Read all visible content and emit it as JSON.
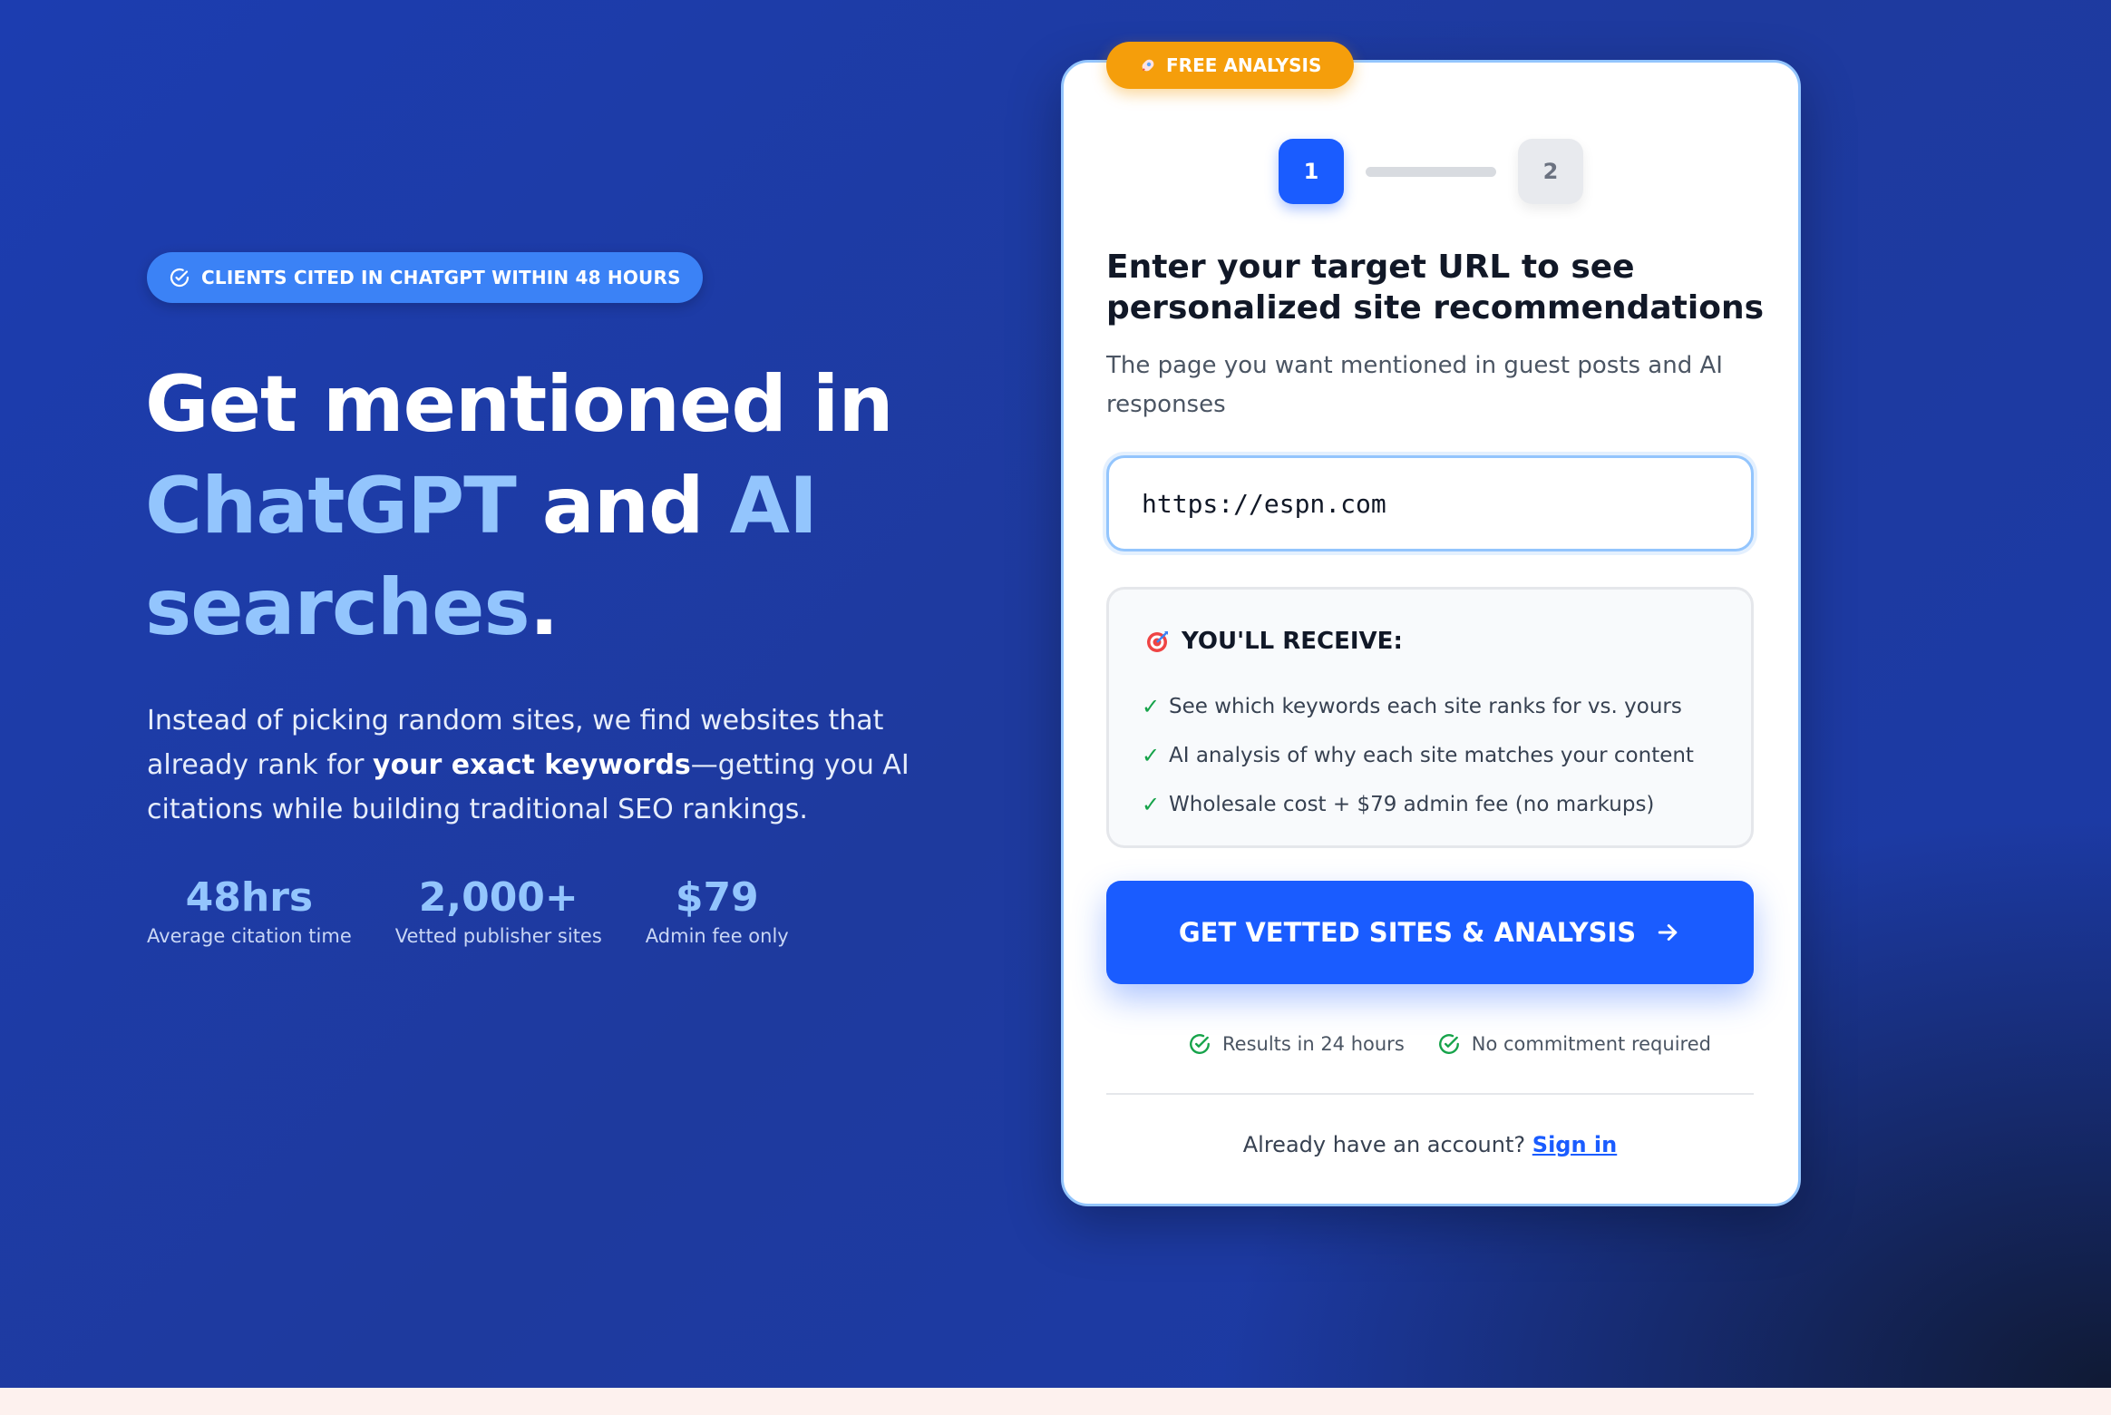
{
  "hero": {
    "pill_label": "CLIENTS CITED IN CHATGPT WITHIN 48 HOURS",
    "headline": {
      "part1": "Get mentioned in",
      "highlight1": "ChatGPT",
      "part2": "and",
      "highlight2": "AI",
      "highlight3": "searches",
      "end": "."
    },
    "description": {
      "before": "Instead of picking random sites, we find websites that already rank for",
      "bold": "your exact keywords",
      "after": "—getting you AI citations while building traditional SEO rankings."
    },
    "stats": [
      {
        "value": "48hrs",
        "label": "Average citation time"
      },
      {
        "value": "2,000+",
        "label": "Vetted publisher sites"
      },
      {
        "value": "$79",
        "label": "Admin fee only"
      }
    ]
  },
  "card": {
    "badge_label": "FREE ANALYSIS",
    "steps": [
      "1",
      "2"
    ],
    "active_step": 1,
    "title": "Enter your target URL to see personalized site recommendations",
    "subtitle": "The page you want mentioned in guest posts and AI responses",
    "url_input": {
      "value": "https://espn.com"
    },
    "receive": {
      "title": "YOU'LL RECEIVE:",
      "items": [
        "See which keywords each site ranks for vs. yours",
        "AI analysis of why each site matches your content",
        "Wholesale cost + $79 admin fee (no markups)"
      ]
    },
    "cta_label": "GET VETTED SITES & ANALYSIS",
    "assurances": [
      "Results in 24 hours",
      "No commitment required"
    ],
    "signin": {
      "prompt": "Already have an account?",
      "link": "Sign in"
    }
  },
  "colors": {
    "accent": "#1a5cff",
    "highlight": "#93c5fd",
    "badge": "#f59e0b",
    "check": "#16a34a"
  },
  "icons": {
    "pill": "check-circle-icon",
    "badge": "rocket-icon",
    "receive": "target-icon",
    "cta": "arrow-right-icon",
    "assurance": "check-circle-icon"
  }
}
